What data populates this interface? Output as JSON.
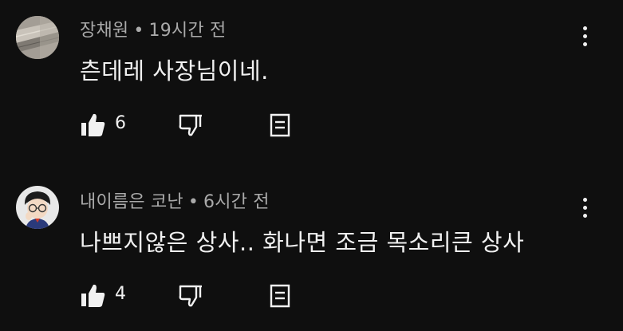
{
  "comments": [
    {
      "author": "장채원",
      "separator": "•",
      "time": "19시간 전",
      "text": "츤데레 사장님이네.",
      "likes": "6",
      "avatar_icon": "wall-photo-avatar",
      "menu_icon": "more-vert-icon"
    },
    {
      "author": "내이름은 코난",
      "separator": "•",
      "time": "6시간 전",
      "text": "나쁘지않은 상사.. 화나면 조금 목소리큰 상사",
      "likes": "4",
      "avatar_icon": "cartoon-boy-avatar",
      "menu_icon": "more-vert-icon"
    }
  ],
  "icons": {
    "like": "thumbs-up-icon",
    "dislike": "thumbs-down-icon",
    "reply": "reply-icon"
  },
  "colors": {
    "background": "#0f0f0f",
    "text": "#f1f1f1",
    "meta": "#aaaaaa"
  }
}
